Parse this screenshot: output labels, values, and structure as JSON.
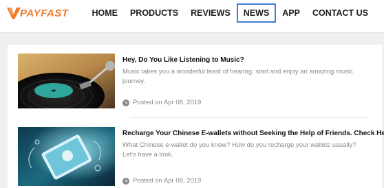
{
  "brand": {
    "logo_text": "PAYFAST"
  },
  "nav": {
    "items": [
      {
        "label": "HOME"
      },
      {
        "label": "PRODUCTS"
      },
      {
        "label": "REVIEWS"
      },
      {
        "label": "NEWS"
      },
      {
        "label": "APP"
      },
      {
        "label": "CONTACT US"
      }
    ],
    "active": "NEWS"
  },
  "articles": [
    {
      "title": "Hey, Do You Like Listening to Music?",
      "description": "Music takes you a wonderful feast of hearing, start and enjoy an amazing music journey.",
      "date": "Posted on Apr 08, 2019",
      "image": "vinyl-record-player"
    },
    {
      "title": "Recharge Your Chinese E-wallets without Seeking the Help of Friends. Check Here!",
      "description": "What Chinese e-wallet do you know? How do you recharge your wallets usually? Let's have a look.",
      "date": "Posted on Apr 08, 2019",
      "image": "smartphone-digital-world"
    }
  ],
  "colors": {
    "brand_orange": "#f07a2a",
    "active_border": "#3d7fd8",
    "page_bg": "#efefef",
    "muted_text": "#8a8a8a"
  },
  "icons": [
    "clock-icon"
  ]
}
